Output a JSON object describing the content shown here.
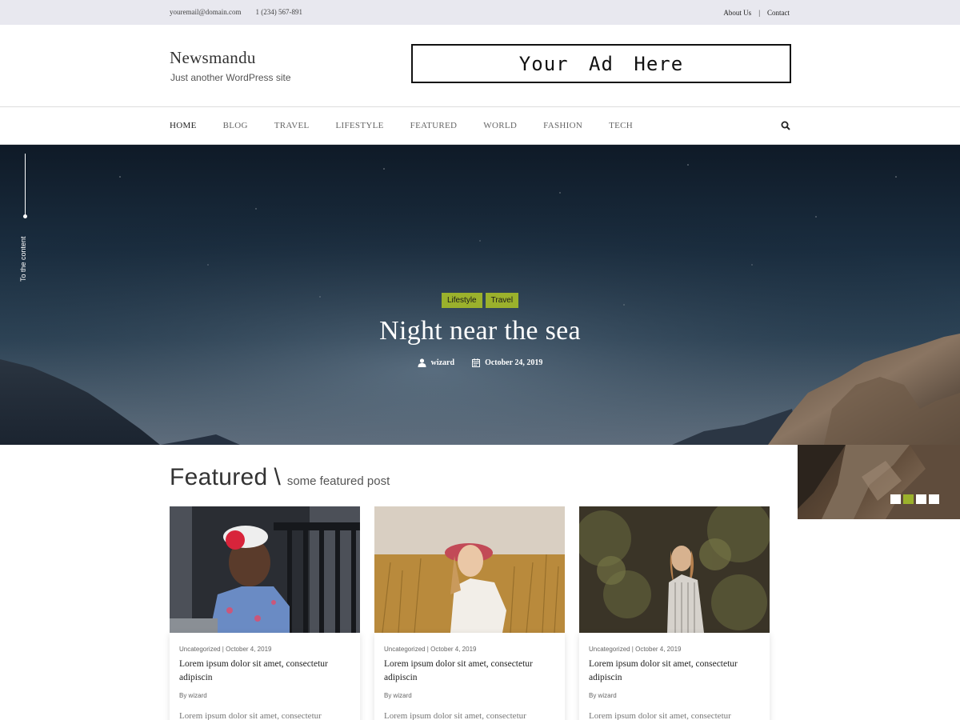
{
  "topbar": {
    "email": "youremail@domain.com",
    "phone": "1 (234) 567-891",
    "links": [
      "About Us",
      "|",
      "Contact"
    ]
  },
  "header": {
    "site_title": "Newsmandu",
    "tagline": "Just another WordPress site",
    "ad_text": "Your Ad Here"
  },
  "nav": {
    "items": [
      "HOME",
      "BLOG",
      "TRAVEL",
      "LIFESTYLE",
      "FEATURED",
      "WORLD",
      "FASHION",
      "TECH"
    ],
    "active": "HOME",
    "search_icon": "search-icon"
  },
  "hero": {
    "to_content": "To the content",
    "tags": [
      "Lifestyle",
      "Travel"
    ],
    "title": "Night near the sea",
    "author": "wizard",
    "date": "October 24, 2019",
    "slider_count": 4,
    "slider_active": 2
  },
  "featured": {
    "heading": "Featured",
    "separator": "\\",
    "subheading": "some featured post",
    "cards": [
      {
        "meta": "Uncategorized | October 4, 2019",
        "title": "Lorem ipsum dolor sit amet, consectetur adipiscin",
        "by": "By wizard",
        "excerpt": "Lorem ipsum dolor sit amet, consectetur"
      },
      {
        "meta": "Uncategorized | October 4, 2019",
        "title": "Lorem ipsum dolor sit amet, consectetur adipiscin",
        "by": "By wizard",
        "excerpt": "Lorem ipsum dolor sit amet, consectetur"
      },
      {
        "meta": "Uncategorized | October 4, 2019",
        "title": "Lorem ipsum dolor sit amet, consectetur adipiscin",
        "by": "By wizard",
        "excerpt": "Lorem ipsum dolor sit amet, consectetur"
      }
    ]
  },
  "colors": {
    "accent": "#9bb12c",
    "topbar_bg": "#e8e8ef"
  }
}
